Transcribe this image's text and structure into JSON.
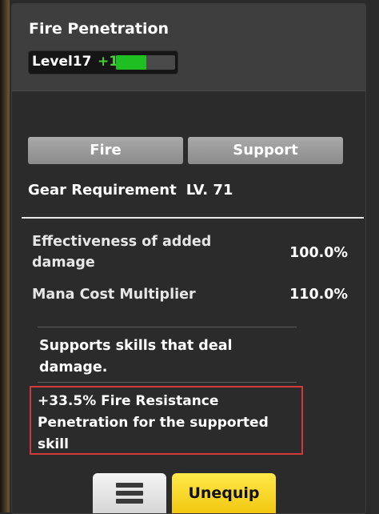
{
  "skill": {
    "name": "Fire Penetration",
    "level_label": "Level17",
    "level_bonus": "+1",
    "level_progress": 0.52
  },
  "tags": [
    "Fire",
    "Support"
  ],
  "gear_requirement": {
    "label": "Gear Requirement",
    "value": "LV. 71"
  },
  "stats": [
    {
      "label": "Effectiveness of added damage",
      "value": "100.0%"
    },
    {
      "label": "Mana Cost Multiplier",
      "value": "110.0%"
    }
  ],
  "description": "Supports skills that deal damage.",
  "bonus": "+33.5% Fire Resistance Penetration for the supported skill",
  "buttons": {
    "menu_icon": "hamburger-menu-icon",
    "unequip": "Unequip"
  },
  "colors": {
    "panel": "#2b2b2b",
    "header": "#3e3e3e",
    "level_bonus": "#4ccb3c",
    "progress_fill": "#1fbf22",
    "highlight_border": "#d23a3a",
    "unequip_button": "#f2c811"
  }
}
